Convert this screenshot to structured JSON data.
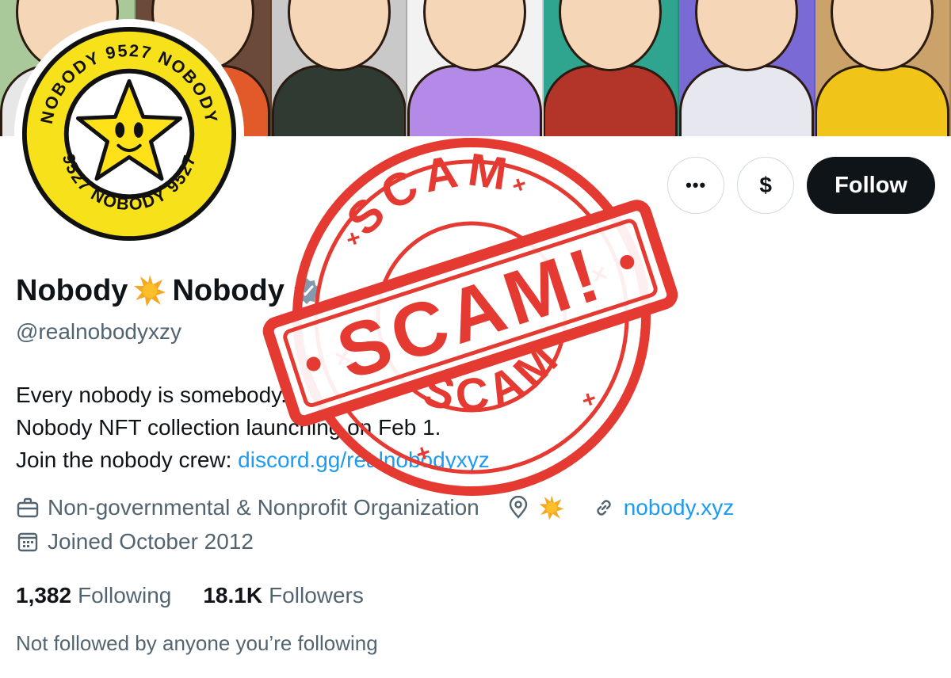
{
  "banner": {
    "tiles": [
      {
        "name": "banner-art-1",
        "bg": "#a9c99a",
        "shirt": "#e7e7e7"
      },
      {
        "name": "banner-art-2",
        "bg": "#6b4a3a",
        "shirt": "#e25a2a"
      },
      {
        "name": "banner-art-3",
        "bg": "#c9c9c9",
        "shirt": "#2f3a33"
      },
      {
        "name": "banner-art-4",
        "bg": "#f2f2f2",
        "shirt": "#b48ae8"
      },
      {
        "name": "banner-art-5",
        "bg": "#2fa58f",
        "shirt": "#b3352a"
      },
      {
        "name": "banner-art-6",
        "bg": "#7a6ad6",
        "shirt": "#e7e7f0"
      },
      {
        "name": "banner-art-7",
        "bg": "#caa26a",
        "shirt": "#f0c419"
      }
    ]
  },
  "avatar": {
    "ring_text_top": "NOBODY 9527 NOBODY",
    "ring_text_bottom": "9527 NOBODY 9527",
    "ring_color": "#f6e11b"
  },
  "actions": {
    "more_label": "•••",
    "tip_label": "$",
    "follow_label": "Follow"
  },
  "profile": {
    "name_part1": "Nobody",
    "name_part2": "Nobody",
    "handle": "@realnobodyxzy",
    "bio_line1": "Every nobody is somebody.",
    "bio_line2": "Nobody NFT collection launching on Feb 1.",
    "bio_line3_prefix": "Join the nobody crew: ",
    "bio_line3_link": "discord.gg/realnobodyxyz",
    "category": "Non-governmental & Nonprofit Organization",
    "website": "nobody.xyz",
    "joined": "Joined October 2012",
    "following_count": "1,382",
    "following_label": "Following",
    "followers_count": "18.1K",
    "followers_label": "Followers",
    "not_followed": "Not followed by anyone you’re following"
  },
  "stamp": {
    "top_text": "SCAM",
    "center_text": "SCAM!",
    "bottom_text": "SCAM",
    "color": "#e43a32"
  }
}
